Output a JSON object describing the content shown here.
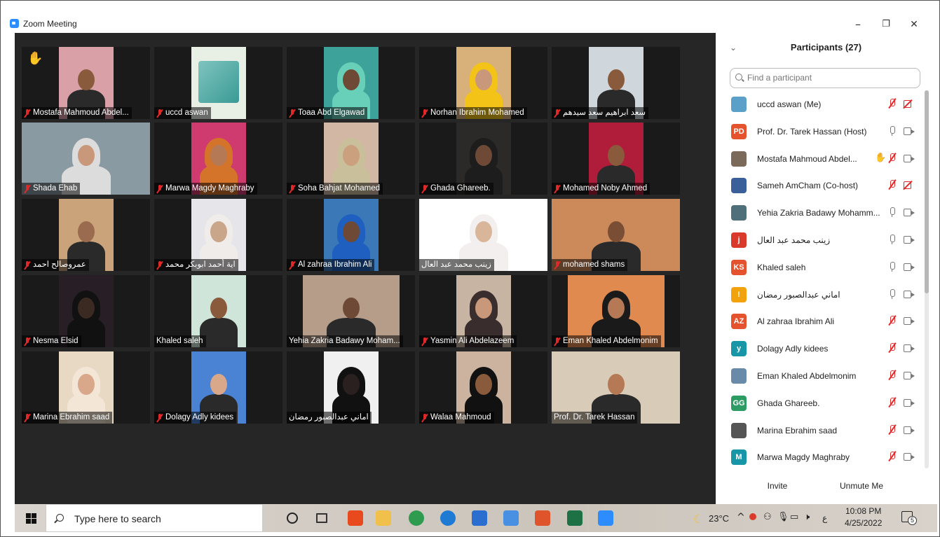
{
  "window": {
    "title": "Zoom Meeting",
    "minimize": "–",
    "restore": "❐",
    "close": "✕"
  },
  "gallery": {
    "tiles": [
      {
        "name": "Mostafa Mahmoud Abdel...",
        "muted": true,
        "hand": true
      },
      {
        "name": "uccd aswan",
        "muted": true
      },
      {
        "name": "Toaa Abd Elgawad",
        "muted": true
      },
      {
        "name": "Norhan Ibrahim Mohamed",
        "muted": true
      },
      {
        "name": "سعد ابراهيم سعد سيدهم",
        "muted": true
      },
      {
        "name": "Shada Ehab",
        "muted": true
      },
      {
        "name": "Marwa Magdy Maghraby",
        "muted": true
      },
      {
        "name": "Soha Bahjat Mohamed",
        "muted": true
      },
      {
        "name": "Ghada Ghareeb.",
        "muted": true
      },
      {
        "name": "Mohamed Noby Ahmed",
        "muted": true
      },
      {
        "name": "عمروصالح احمد",
        "muted": true
      },
      {
        "name": "اية أحمد ابوبكر محمد",
        "muted": true
      },
      {
        "name": "Al zahraa Ibrahim Ali",
        "muted": true
      },
      {
        "name": "زينب محمد عبد العال",
        "muted": false,
        "active": true
      },
      {
        "name": "mohamed shams",
        "muted": true
      },
      {
        "name": "Nesma Elsid",
        "muted": true
      },
      {
        "name": "Khaled saleh",
        "muted": false
      },
      {
        "name": "Yehia Zakria Badawy Moham...",
        "muted": false
      },
      {
        "name": "Yasmin Ali Abdelazeem",
        "muted": true
      },
      {
        "name": "Eman Khaled Abdelmonim",
        "muted": true
      },
      {
        "name": "Marina Ebrahim saad",
        "muted": true
      },
      {
        "name": "Dolagy Adly kidees",
        "muted": true
      },
      {
        "name": "اماني عبدالصبور رمضان",
        "muted": false
      },
      {
        "name": "Walaa Mahmoud",
        "muted": true
      },
      {
        "name": "Prof. Dr. Tarek Hassan",
        "muted": false
      }
    ]
  },
  "panel": {
    "collapse_icon": "⌄",
    "title": "Participants (27)",
    "search_placeholder": "Find a participant",
    "participants": [
      {
        "name": "uccd aswan (Me)",
        "avatar": "",
        "avatar_color": "#5aa0c8",
        "mic": "off",
        "cam": "off"
      },
      {
        "name": "Prof. Dr. Tarek Hassan (Host)",
        "avatar": "PD",
        "avatar_color": "#e5532e",
        "mic": "on",
        "cam": "on"
      },
      {
        "name": "Mostafa Mahmoud Abdel...",
        "avatar": "",
        "avatar_color": "#7b6a5a",
        "mic": "off",
        "cam": "on",
        "hand": true
      },
      {
        "name": "Sameh AmCham (Co-host)",
        "avatar": "",
        "avatar_color": "#3a5f9a",
        "mic": "off",
        "cam": "off"
      },
      {
        "name": "Yehia Zakria Badawy Mohamm...",
        "avatar": "",
        "avatar_color": "#4f6f7a",
        "mic": "on",
        "cam": "on"
      },
      {
        "name": "زينب محمد عبد العال",
        "avatar": "j",
        "avatar_color": "#d93a2b",
        "mic": "on",
        "cam": "on"
      },
      {
        "name": "Khaled saleh",
        "avatar": "KS",
        "avatar_color": "#e5532e",
        "mic": "on",
        "cam": "on"
      },
      {
        "name": "اماني عبدالصبور رمضان",
        "avatar": "!",
        "avatar_color": "#f2a20c",
        "mic": "on",
        "cam": "on"
      },
      {
        "name": "Al zahraa Ibrahim Ali",
        "avatar": "AZ",
        "avatar_color": "#e5532e",
        "mic": "off",
        "cam": "on"
      },
      {
        "name": "Dolagy Adly kidees",
        "avatar": "y",
        "avatar_color": "#1796a8",
        "mic": "off",
        "cam": "on"
      },
      {
        "name": "Eman Khaled Abdelmonim",
        "avatar": "",
        "avatar_color": "#6a8aaa",
        "mic": "off",
        "cam": "on"
      },
      {
        "name": "Ghada Ghareeb.",
        "avatar": "GG",
        "avatar_color": "#2d9c64",
        "mic": "off",
        "cam": "on"
      },
      {
        "name": "Marina Ebrahim saad",
        "avatar": "",
        "avatar_color": "#555",
        "mic": "off",
        "cam": "on"
      },
      {
        "name": "Marwa Magdy Maghraby",
        "avatar": "M",
        "avatar_color": "#1796a8",
        "mic": "off",
        "cam": "on"
      }
    ],
    "invite": "Invite",
    "unmute_me": "Unmute Me"
  },
  "taskbar": {
    "search_text": "Type here to search",
    "weather": "23°C",
    "lang": "ع",
    "time": "10:08 PM",
    "date": "4/25/2022",
    "notifications": "5",
    "icons": [
      "cortana-icon",
      "task-view-icon",
      "office-icon",
      "file-explorer-icon",
      "chrome-icon",
      "edge-icon",
      "mail-icon",
      "app-icon",
      "video-app-icon",
      "excel-icon",
      "zoom-icon"
    ]
  }
}
